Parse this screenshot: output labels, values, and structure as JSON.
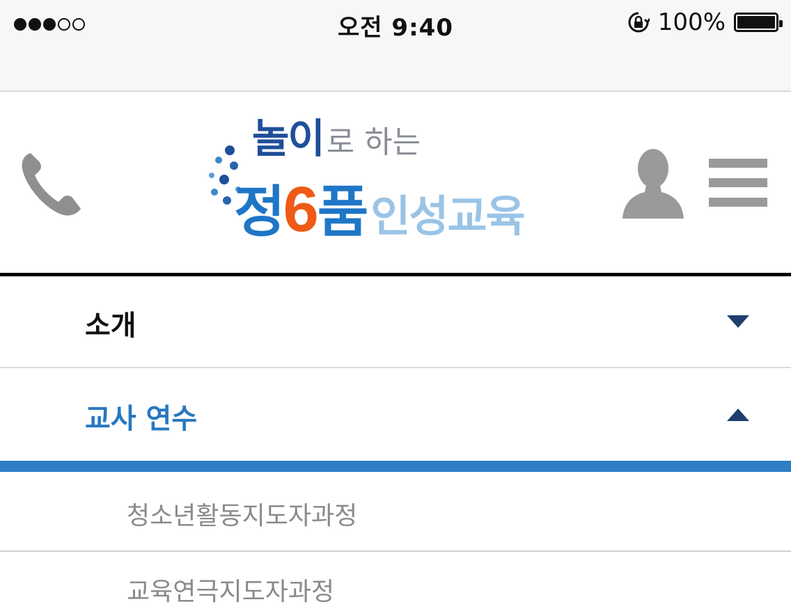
{
  "status_bar": {
    "time": "오전 9:40",
    "battery_percent": "100%",
    "signal_bars_filled": 3,
    "signal_bars_total": 5
  },
  "header": {
    "logo": {
      "line1_bold": "놀이",
      "line1_light": "로 하는",
      "line2_prefix": "정",
      "line2_number": "6",
      "line2_suffix": "품",
      "line2_light": "인성교육"
    },
    "icons": [
      "phone-icon",
      "user-icon",
      "menu-icon"
    ]
  },
  "menu": {
    "items": [
      {
        "label": "소개",
        "expanded": false
      },
      {
        "label": "교사 연수",
        "expanded": true,
        "children": [
          "청소년활동지도자과정",
          "교육연극지도자과정"
        ]
      }
    ]
  },
  "colors": {
    "accent_blue": "#2f7dc4",
    "active_label": "#2878c0",
    "caret": "#1e3f6e",
    "logo_orange": "#ef5a16"
  }
}
